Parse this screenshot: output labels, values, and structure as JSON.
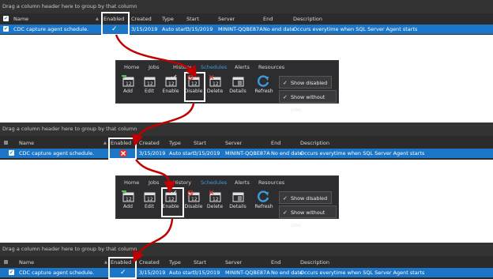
{
  "grid": {
    "group_hint": "Drag a column header here to group by that column",
    "columns": [
      "Name",
      "Enabled",
      "Created",
      "Type",
      "Start",
      "Server",
      "End",
      "Description"
    ],
    "row": {
      "name": "CDC capture agent schedule.",
      "created": "3/15/2019",
      "type": "Auto start",
      "start": "3/15/2019",
      "server": "MININT-QQBE87A",
      "end": "No end date",
      "description": "Occurs everytime when SQL Server Agent starts"
    }
  },
  "ribbon": {
    "tabs": [
      "Home",
      "Jobs",
      "History",
      "Schedules",
      "Alerts",
      "Resources"
    ],
    "active_tab": "Schedules",
    "buttons": [
      "Add",
      "Edit",
      "Enable",
      "Disable",
      "Delete",
      "Details",
      "Refresh"
    ],
    "options": [
      "Show disabled",
      "Show without jobs"
    ]
  },
  "steps": [
    {
      "enabled_state": "enabled",
      "highlight": "Enabled column"
    },
    {
      "highlight_button": "Disable"
    },
    {
      "enabled_state": "disabled",
      "highlight": "Enabled column"
    },
    {
      "highlight_button": "Enable"
    },
    {
      "enabled_state": "enabled",
      "highlight": "Enabled column"
    }
  ],
  "colors": {
    "panel_bg": "#2b2b2b",
    "selected_row": "#1c76c8",
    "arrow": "#c00000",
    "active_tab": "#3c9be0",
    "disabled_mark": "#e0302a"
  }
}
